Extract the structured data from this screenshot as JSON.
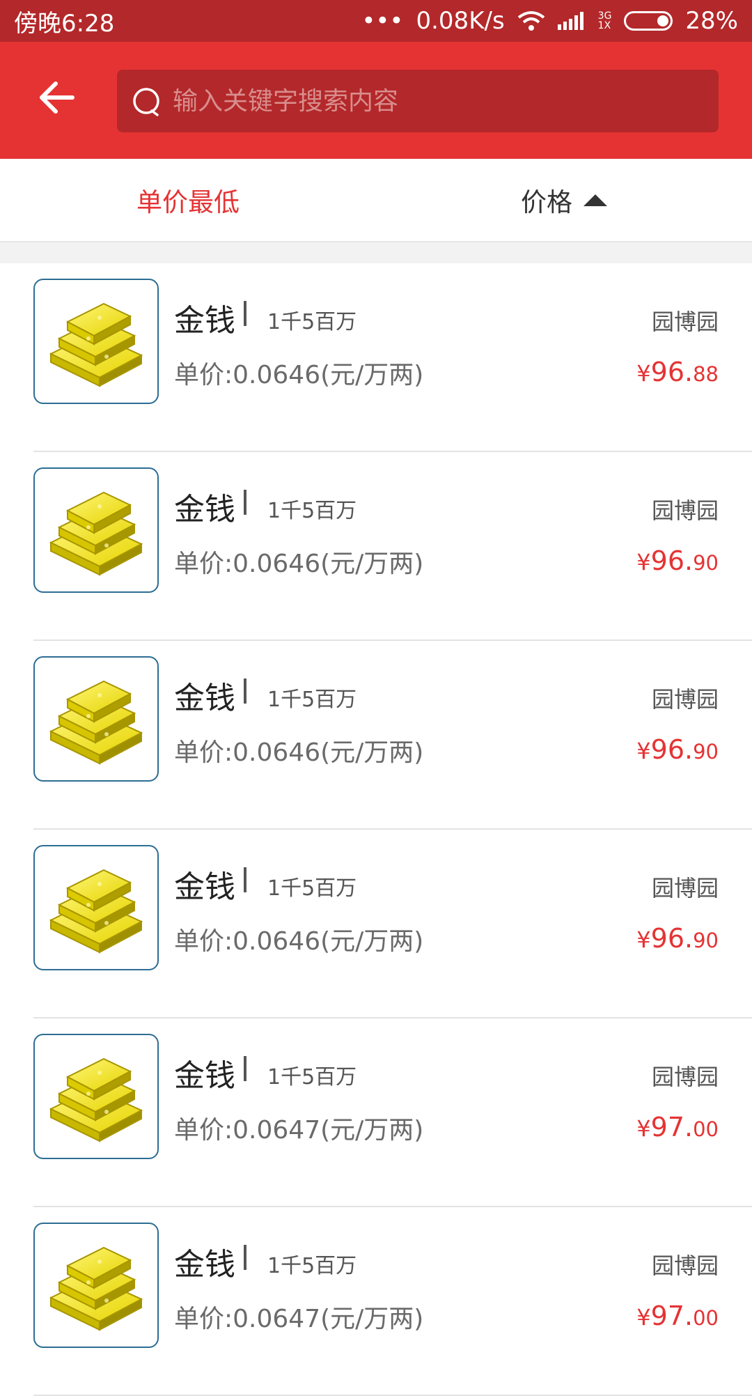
{
  "status_bar": {
    "time": "傍晚6:28",
    "dots": "•••",
    "speed": "0.08K/s",
    "net_top": "3G",
    "net_bottom": "1X",
    "battery": "28%"
  },
  "search": {
    "placeholder": "输入关键字搜索内容"
  },
  "sort": {
    "tab1": "单价最低",
    "tab2": "价格"
  },
  "items": [
    {
      "name": "金钱",
      "qty": "1千5百万",
      "unit_price": "单价:0.0646(元/万两)",
      "server": "园博园",
      "currency": "¥",
      "price_int": "96.",
      "price_dec": "88"
    },
    {
      "name": "金钱",
      "qty": "1千5百万",
      "unit_price": "单价:0.0646(元/万两)",
      "server": "园博园",
      "currency": "¥",
      "price_int": "96.",
      "price_dec": "90"
    },
    {
      "name": "金钱",
      "qty": "1千5百万",
      "unit_price": "单价:0.0646(元/万两)",
      "server": "园博园",
      "currency": "¥",
      "price_int": "96.",
      "price_dec": "90"
    },
    {
      "name": "金钱",
      "qty": "1千5百万",
      "unit_price": "单价:0.0646(元/万两)",
      "server": "园博园",
      "currency": "¥",
      "price_int": "96.",
      "price_dec": "90"
    },
    {
      "name": "金钱",
      "qty": "1千5百万",
      "unit_price": "单价:0.0647(元/万两)",
      "server": "园博园",
      "currency": "¥",
      "price_int": "97.",
      "price_dec": "00"
    },
    {
      "name": "金钱",
      "qty": "1千5百万",
      "unit_price": "单价:0.0647(元/万两)",
      "server": "园博园",
      "currency": "¥",
      "price_int": "97.",
      "price_dec": "00"
    }
  ],
  "colors": {
    "accent": "#e53334",
    "status_bar": "#b3282a"
  }
}
